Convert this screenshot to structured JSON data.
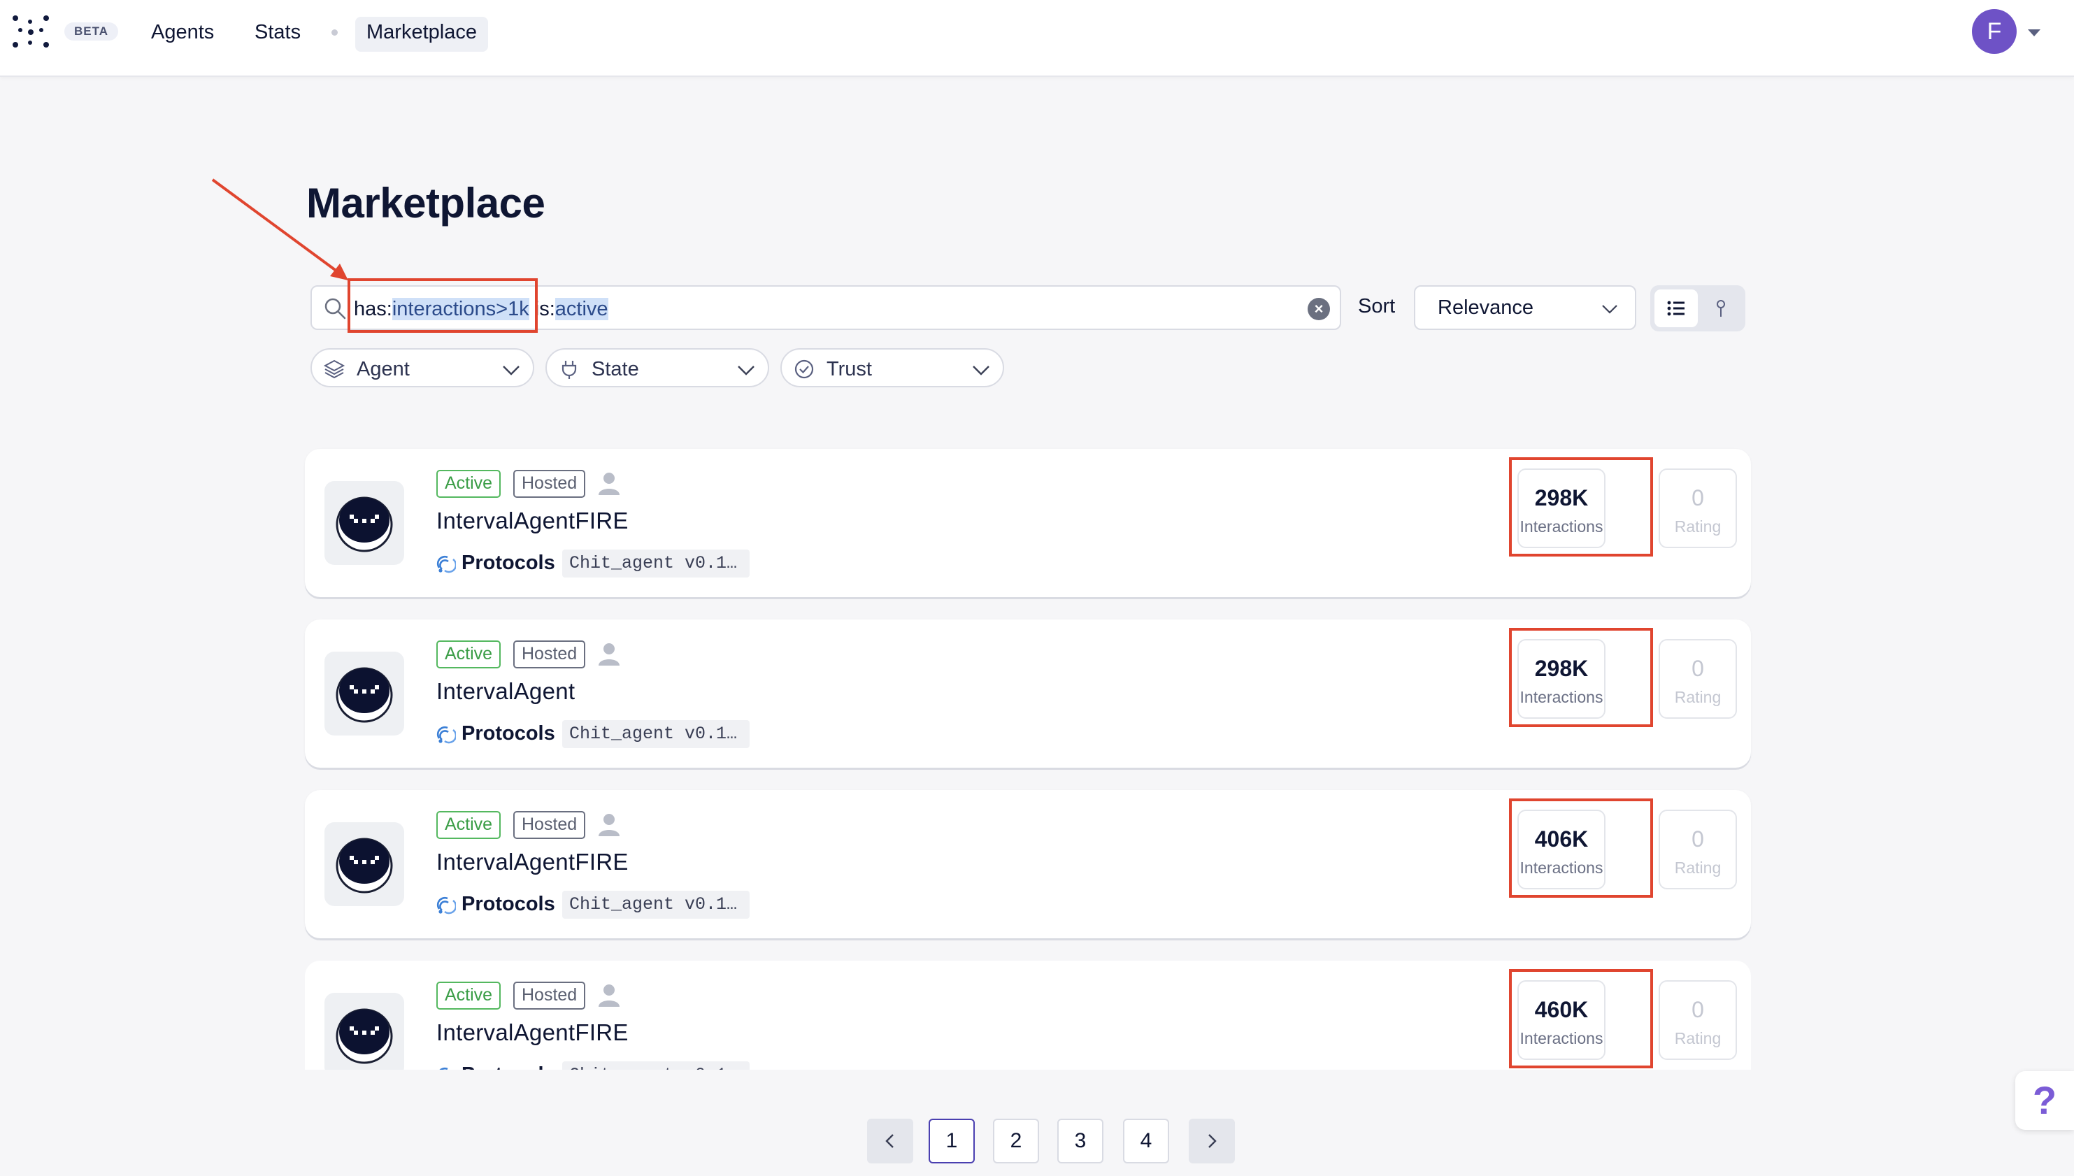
{
  "nav": {
    "beta": "BETA",
    "links": [
      "Agents",
      "Stats",
      "Marketplace"
    ],
    "avatar_initial": "F"
  },
  "page": {
    "title": "Marketplace"
  },
  "search": {
    "prefix1": "has:",
    "value1": "interactions>1k",
    "prefix2": "is:",
    "value2": "active"
  },
  "sort": {
    "label": "Sort",
    "value": "Relevance"
  },
  "filters": [
    "Agent",
    "State",
    "Trust"
  ],
  "agents": [
    {
      "status": "Active",
      "hosting": "Hosted",
      "name": "IntervalAgentFIRE",
      "protocols_label": "Protocols",
      "protocol": "Chit_agent v0.1…",
      "interactions": "298K",
      "interactions_label": "Interactions",
      "rating": "0",
      "rating_label": "Rating"
    },
    {
      "status": "Active",
      "hosting": "Hosted",
      "name": "IntervalAgent",
      "protocols_label": "Protocols",
      "protocol": "Chit_agent v0.1…",
      "interactions": "298K",
      "interactions_label": "Interactions",
      "rating": "0",
      "rating_label": "Rating"
    },
    {
      "status": "Active",
      "hosting": "Hosted",
      "name": "IntervalAgentFIRE",
      "protocols_label": "Protocols",
      "protocol": "Chit_agent v0.1…",
      "interactions": "406K",
      "interactions_label": "Interactions",
      "rating": "0",
      "rating_label": "Rating"
    },
    {
      "status": "Active",
      "hosting": "Hosted",
      "name": "IntervalAgentFIRE",
      "protocols_label": "Protocols",
      "protocol": "Chit_agent v0.1…",
      "interactions": "460K",
      "interactions_label": "Interactions",
      "rating": "0",
      "rating_label": "Rating"
    }
  ],
  "pagination": {
    "pages": [
      "1",
      "2",
      "3",
      "4"
    ],
    "current": "1"
  },
  "help": {
    "label": "?"
  },
  "colors": {
    "accent": "#4a3fb0",
    "annotation": "#e0452f",
    "active_green": "#3a9d46",
    "avatar": "#6e52c6"
  },
  "icons": [
    "logo-icon",
    "search-icon",
    "clear-icon",
    "chevron-down-icon",
    "list-view-icon",
    "map-pin-icon",
    "layers-icon",
    "plug-icon",
    "check-circle-icon",
    "user-icon",
    "robot-avatar-icon",
    "protocol-icon",
    "chevron-left-icon",
    "chevron-right-icon",
    "help-icon"
  ]
}
